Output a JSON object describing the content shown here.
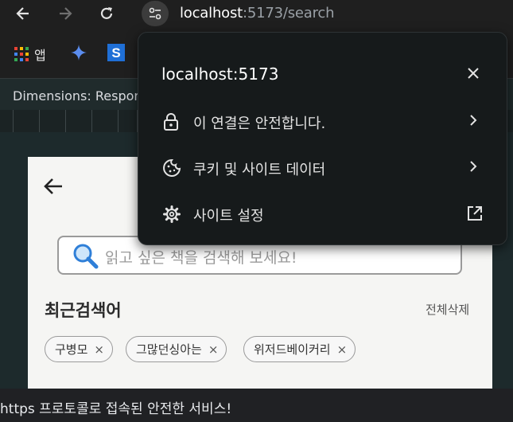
{
  "browser": {
    "url_host": "localhost",
    "url_path": ":5173/search",
    "nav": {
      "back_icon": "arrow-left-icon",
      "forward_icon": "arrow-right-icon",
      "reload_icon": "reload-icon",
      "site_info_icon": "tune-icon"
    },
    "bookmarks": [
      {
        "icon": "apps-grid-icon",
        "label": "앱"
      },
      {
        "icon": "gemini-star-icon",
        "label": ""
      },
      {
        "icon": "s-logo-icon",
        "label": ""
      }
    ],
    "status_text": "https 프로토콜로 접속된 안전한 서비스!"
  },
  "devtools": {
    "dimensions_text": "Dimensions: Respor"
  },
  "site_info_popup": {
    "title": "localhost:5173",
    "items": [
      {
        "icon": "lock-icon",
        "label": "이 연결은 안전합니다.",
        "trailing_icon": "chevron-right-icon"
      },
      {
        "icon": "cookie-icon",
        "label": "쿠키 및 사이트 데이터",
        "trailing_icon": "chevron-right-icon"
      },
      {
        "icon": "gear-icon",
        "label": "사이트 설정",
        "trailing_icon": "open-in-new-icon"
      }
    ]
  },
  "app": {
    "search_placeholder": "읽고 싶은 책을 검색해 보세요!",
    "recent_title": "최근검색어",
    "clear_all_label": "전체삭제",
    "recent_chips": [
      "구병모",
      "그많던싱아는",
      "위저드베이커리"
    ],
    "chip_remove_glyph": "×"
  },
  "colors": {
    "browser_bg": "#1f1f1f",
    "popup_bg": "#161a1b",
    "page_bg": "#f5f5f3",
    "search_icon_blue": "#2f7fd8"
  }
}
